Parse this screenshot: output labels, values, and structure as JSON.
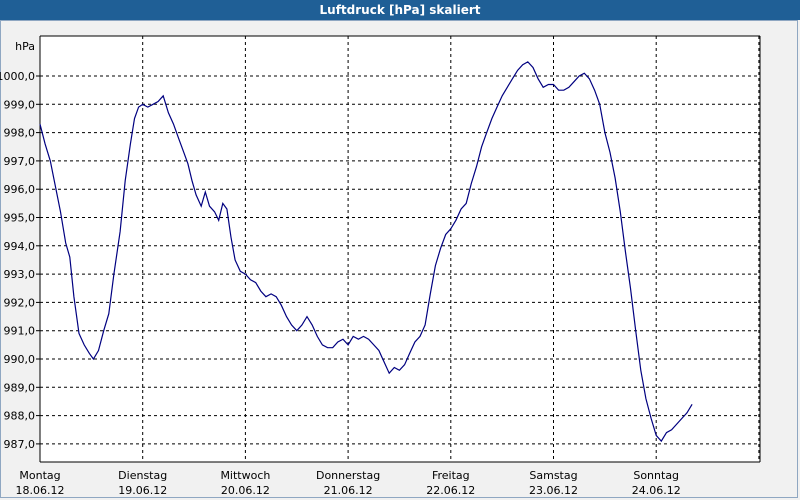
{
  "window": {
    "title": "Luftdruck [hPa] skaliert"
  },
  "chart_data": {
    "type": "line",
    "title": "Luftdruck [hPa] skaliert",
    "ylabel": "hPa",
    "xlabel": "",
    "ylim": [
      986.2,
      1001.4
    ],
    "yticks": [
      "1000,0",
      "999,0",
      "998,0",
      "997,0",
      "996,0",
      "995,0",
      "994,0",
      "993,0",
      "992,0",
      "991,0",
      "990,0",
      "989,0",
      "988,0",
      "987,0"
    ],
    "ytick_values": [
      1000,
      999,
      998,
      997,
      996,
      995,
      994,
      993,
      992,
      991,
      990,
      989,
      988,
      987
    ],
    "xlim": [
      0,
      7
    ],
    "xticks": [
      {
        "day": "Montag",
        "date": "18.06.12"
      },
      {
        "day": "Dienstag",
        "date": "19.06.12"
      },
      {
        "day": "Mittwoch",
        "date": "20.06.12"
      },
      {
        "day": "Donnerstag",
        "date": "21.06.12"
      },
      {
        "day": "Freitag",
        "date": "22.06.12"
      },
      {
        "day": "Samstag",
        "date": "23.06.12"
      },
      {
        "day": "Sonntag",
        "date": "24.06.12"
      }
    ],
    "grid": true,
    "line_color": "#000080",
    "series": [
      {
        "points": [
          [
            0.0,
            998.3
          ],
          [
            0.05,
            997.6
          ],
          [
            0.1,
            997.0
          ],
          [
            0.15,
            996.1
          ],
          [
            0.2,
            995.2
          ],
          [
            0.25,
            994.1
          ],
          [
            0.29,
            993.6
          ],
          [
            0.33,
            992.2
          ],
          [
            0.38,
            990.9
          ],
          [
            0.43,
            990.5
          ],
          [
            0.48,
            990.2
          ],
          [
            0.52,
            990.0
          ],
          [
            0.57,
            990.3
          ],
          [
            0.62,
            991.0
          ],
          [
            0.67,
            991.6
          ],
          [
            0.72,
            993.0
          ],
          [
            0.78,
            994.5
          ],
          [
            0.83,
            996.3
          ],
          [
            0.88,
            997.6
          ],
          [
            0.92,
            998.5
          ],
          [
            0.96,
            998.9
          ],
          [
            1.0,
            999.0
          ],
          [
            1.05,
            998.9
          ],
          [
            1.1,
            999.0
          ],
          [
            1.15,
            999.1
          ],
          [
            1.2,
            999.3
          ],
          [
            1.25,
            998.7
          ],
          [
            1.3,
            998.3
          ],
          [
            1.35,
            997.8
          ],
          [
            1.4,
            997.3
          ],
          [
            1.44,
            996.9
          ],
          [
            1.48,
            996.3
          ],
          [
            1.52,
            995.8
          ],
          [
            1.57,
            995.4
          ],
          [
            1.61,
            995.9
          ],
          [
            1.65,
            995.4
          ],
          [
            1.7,
            995.2
          ],
          [
            1.74,
            994.9
          ],
          [
            1.78,
            995.5
          ],
          [
            1.82,
            995.3
          ],
          [
            1.86,
            994.3
          ],
          [
            1.9,
            993.5
          ],
          [
            1.95,
            993.1
          ],
          [
            2.0,
            993.0
          ],
          [
            2.05,
            992.8
          ],
          [
            2.1,
            992.7
          ],
          [
            2.15,
            992.4
          ],
          [
            2.2,
            992.2
          ],
          [
            2.25,
            992.3
          ],
          [
            2.3,
            992.2
          ],
          [
            2.35,
            991.9
          ],
          [
            2.4,
            991.5
          ],
          [
            2.45,
            991.2
          ],
          [
            2.5,
            991.0
          ],
          [
            2.55,
            991.2
          ],
          [
            2.6,
            991.5
          ],
          [
            2.65,
            991.2
          ],
          [
            2.7,
            990.8
          ],
          [
            2.75,
            990.5
          ],
          [
            2.8,
            990.4
          ],
          [
            2.85,
            990.4
          ],
          [
            2.9,
            990.6
          ],
          [
            2.95,
            990.7
          ],
          [
            3.0,
            990.5
          ],
          [
            3.05,
            990.8
          ],
          [
            3.1,
            990.7
          ],
          [
            3.15,
            990.8
          ],
          [
            3.2,
            990.7
          ],
          [
            3.25,
            990.5
          ],
          [
            3.3,
            990.3
          ],
          [
            3.35,
            989.9
          ],
          [
            3.4,
            989.5
          ],
          [
            3.45,
            989.7
          ],
          [
            3.5,
            989.6
          ],
          [
            3.55,
            989.8
          ],
          [
            3.6,
            990.2
          ],
          [
            3.65,
            990.6
          ],
          [
            3.7,
            990.8
          ],
          [
            3.75,
            991.2
          ],
          [
            3.8,
            992.3
          ],
          [
            3.85,
            993.3
          ],
          [
            3.9,
            993.9
          ],
          [
            3.95,
            994.4
          ],
          [
            4.0,
            994.6
          ],
          [
            4.05,
            994.9
          ],
          [
            4.1,
            995.3
          ],
          [
            4.15,
            995.5
          ],
          [
            4.2,
            996.2
          ],
          [
            4.25,
            996.8
          ],
          [
            4.3,
            997.5
          ],
          [
            4.35,
            998.0
          ],
          [
            4.4,
            998.5
          ],
          [
            4.45,
            998.9
          ],
          [
            4.5,
            999.3
          ],
          [
            4.55,
            999.6
          ],
          [
            4.6,
            999.9
          ],
          [
            4.65,
            1000.2
          ],
          [
            4.7,
            1000.4
          ],
          [
            4.75,
            1000.5
          ],
          [
            4.8,
            1000.3
          ],
          [
            4.85,
            999.9
          ],
          [
            4.9,
            999.6
          ],
          [
            4.95,
            999.7
          ],
          [
            5.0,
            999.7
          ],
          [
            5.05,
            999.5
          ],
          [
            5.1,
            999.5
          ],
          [
            5.15,
            999.6
          ],
          [
            5.2,
            999.8
          ],
          [
            5.25,
            1000.0
          ],
          [
            5.3,
            1000.1
          ],
          [
            5.35,
            999.9
          ],
          [
            5.4,
            999.5
          ],
          [
            5.45,
            999.0
          ],
          [
            5.5,
            998.0
          ],
          [
            5.55,
            997.3
          ],
          [
            5.6,
            996.4
          ],
          [
            5.65,
            995.2
          ],
          [
            5.7,
            993.8
          ],
          [
            5.75,
            992.5
          ],
          [
            5.8,
            991.0
          ],
          [
            5.85,
            989.6
          ],
          [
            5.9,
            988.6
          ],
          [
            5.95,
            987.9
          ],
          [
            6.0,
            987.3
          ],
          [
            6.05,
            987.1
          ],
          [
            6.1,
            987.4
          ],
          [
            6.15,
            987.5
          ],
          [
            6.2,
            987.7
          ],
          [
            6.25,
            987.9
          ],
          [
            6.3,
            988.1
          ],
          [
            6.35,
            988.4
          ]
        ]
      }
    ]
  }
}
